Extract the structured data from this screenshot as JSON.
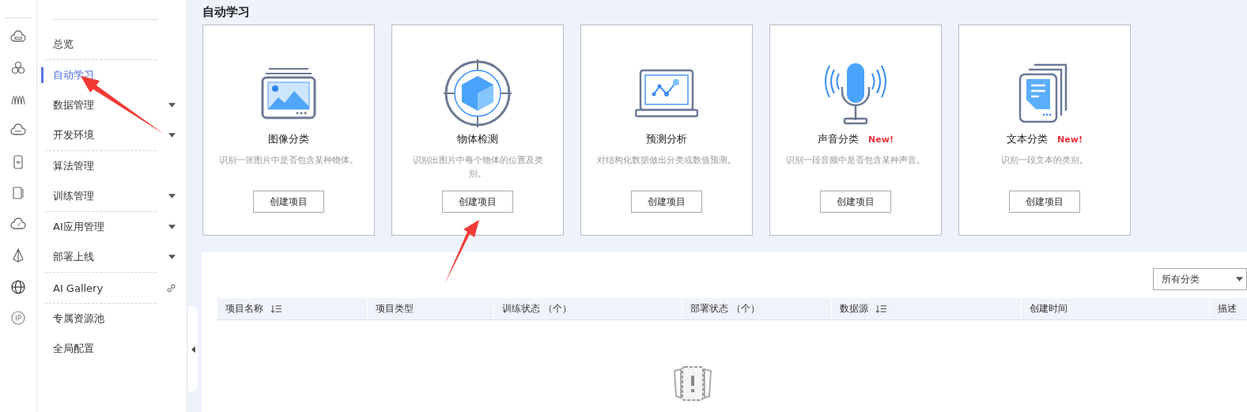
{
  "page": {
    "title": "自动学习"
  },
  "nav": [
    {
      "label": "总览",
      "kind": "plain",
      "selected": false,
      "divider_after": true
    },
    {
      "label": "自动学习",
      "kind": "plain",
      "selected": true,
      "divider_after": false
    },
    {
      "label": "数据管理",
      "kind": "expandable",
      "selected": false,
      "divider_after": false
    },
    {
      "label": "开发环境",
      "kind": "expandable",
      "selected": false,
      "divider_after": true
    },
    {
      "label": "算法管理",
      "kind": "plain",
      "selected": false,
      "divider_after": false
    },
    {
      "label": "训练管理",
      "kind": "expandable",
      "selected": false,
      "divider_after": true
    },
    {
      "label": "AI应用管理",
      "kind": "expandable",
      "selected": false,
      "divider_after": false
    },
    {
      "label": "部署上线",
      "kind": "expandable",
      "selected": false,
      "divider_after": true
    },
    {
      "label": "AI Gallery",
      "kind": "link",
      "selected": false,
      "divider_after": true
    },
    {
      "label": "专属资源池",
      "kind": "plain",
      "selected": false,
      "divider_after": false
    },
    {
      "label": "全局配置",
      "kind": "plain",
      "selected": false,
      "divider_after": false
    }
  ],
  "cards": [
    {
      "kind": "image",
      "title": "图像分类",
      "description": "识别一张图片中是否包含某种物体。",
      "button": "创建项目"
    },
    {
      "kind": "object",
      "title": "物体检测",
      "description": "识别出图片中每个物体的位置及类别。",
      "button": "创建项目"
    },
    {
      "kind": "predict",
      "title": "预测分析",
      "description": "对结构化数据做出分类或数值预测。",
      "button": "创建项目"
    },
    {
      "kind": "sound",
      "title": "声音分类",
      "badge": "New!",
      "description": "识别一段音频中是否包含某种声音。",
      "button": "创建项目"
    },
    {
      "kind": "text",
      "title": "文本分类",
      "badge": "New!",
      "description": "识别一段文本的类别。",
      "button": "创建项目"
    }
  ],
  "filter": {
    "value": "所有分类"
  },
  "table": {
    "columns": [
      {
        "label": "项目名称",
        "sortable": true
      },
      {
        "label": "项目类型",
        "sortable": false
      },
      {
        "label": "训练状态 （个）",
        "sortable": false
      },
      {
        "label": "部署状态 （个）",
        "sortable": false
      },
      {
        "label": "数据源",
        "sortable": true
      },
      {
        "label": "创建时间",
        "sortable": false
      },
      {
        "label": "描述",
        "sortable": false
      }
    ]
  }
}
